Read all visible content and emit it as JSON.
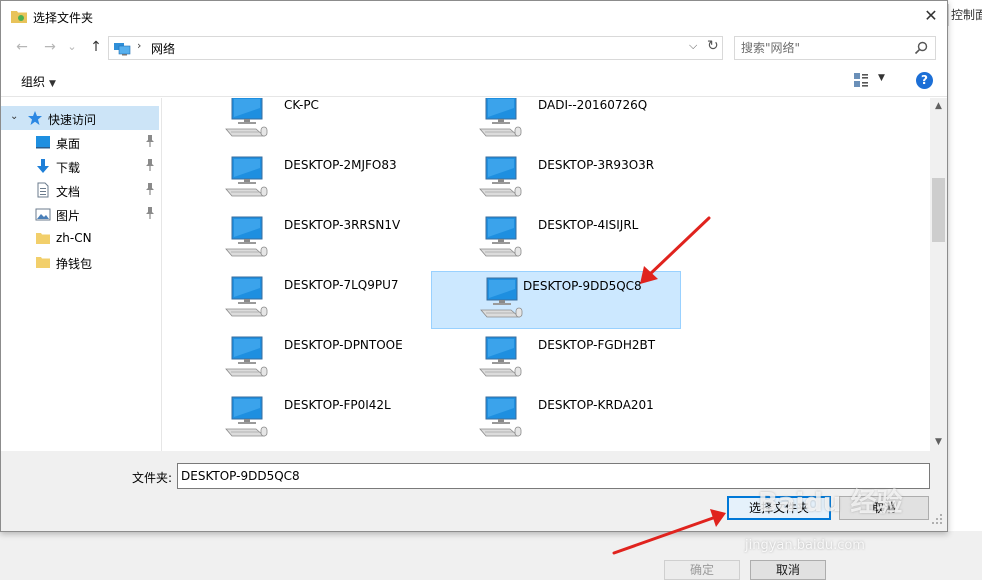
{
  "background": {
    "control_panel_tab": "控制面板",
    "ok_label": "确定",
    "cancel_label": "取消"
  },
  "dialog": {
    "title": "选择文件夹",
    "close_glyph": "✕"
  },
  "navbar": {
    "back_glyph": "←",
    "forward_glyph": "→",
    "dropdown_glyph": "⌄",
    "up_glyph": "↑",
    "address_separator": "›",
    "address": "网络",
    "address_dropdown_glyph": "⌵",
    "refresh_glyph": "↻",
    "search_placeholder": "搜索\"网络\""
  },
  "toolbar": {
    "organize_label": "组织",
    "organize_caret": "▼",
    "view_caret": "▼",
    "help_glyph": "?"
  },
  "sidebar": {
    "quick_access": "快速访问",
    "expand_glyph": "⌄",
    "items": [
      {
        "label": "桌面",
        "icon": "desktop-icon",
        "pinned": true
      },
      {
        "label": "下载",
        "icon": "download-icon",
        "pinned": true
      },
      {
        "label": "文档",
        "icon": "document-icon",
        "pinned": true
      },
      {
        "label": "图片",
        "icon": "picture-icon",
        "pinned": true
      },
      {
        "label": "zh-CN",
        "icon": "folder-icon",
        "pinned": false
      },
      {
        "label": "挣钱包",
        "icon": "folder-icon",
        "pinned": false
      }
    ]
  },
  "computers": [
    "CK-PC",
    "DADI--20160726Q",
    "DESKTOP-2MJFO83",
    "DESKTOP-3R93O3R",
    "DESKTOP-3RRSN1V",
    "DESKTOP-4ISIJRL",
    "DESKTOP-7LQ9PU7",
    "DESKTOP-9DD5QC8",
    "DESKTOP-DPNTOOE",
    "DESKTOP-FGDH2BT",
    "DESKTOP-FP0I42L",
    "DESKTOP-KRDA201"
  ],
  "selected_computer": "DESKTOP-9DD5QC8",
  "scrollbar": {
    "up_glyph": "▲",
    "down_glyph": "▼"
  },
  "bottom": {
    "folder_label": "文件夹:",
    "folder_value": "DESKTOP-9DD5QC8",
    "select_button": "选择文件夹",
    "cancel_button": "取消"
  },
  "watermark": {
    "brand": "Baidu 经验",
    "url": "jingyan.baidu.com"
  },
  "colors": {
    "accent": "#0078d7",
    "selection": "#cce8ff",
    "arrow": "#e0231e"
  }
}
